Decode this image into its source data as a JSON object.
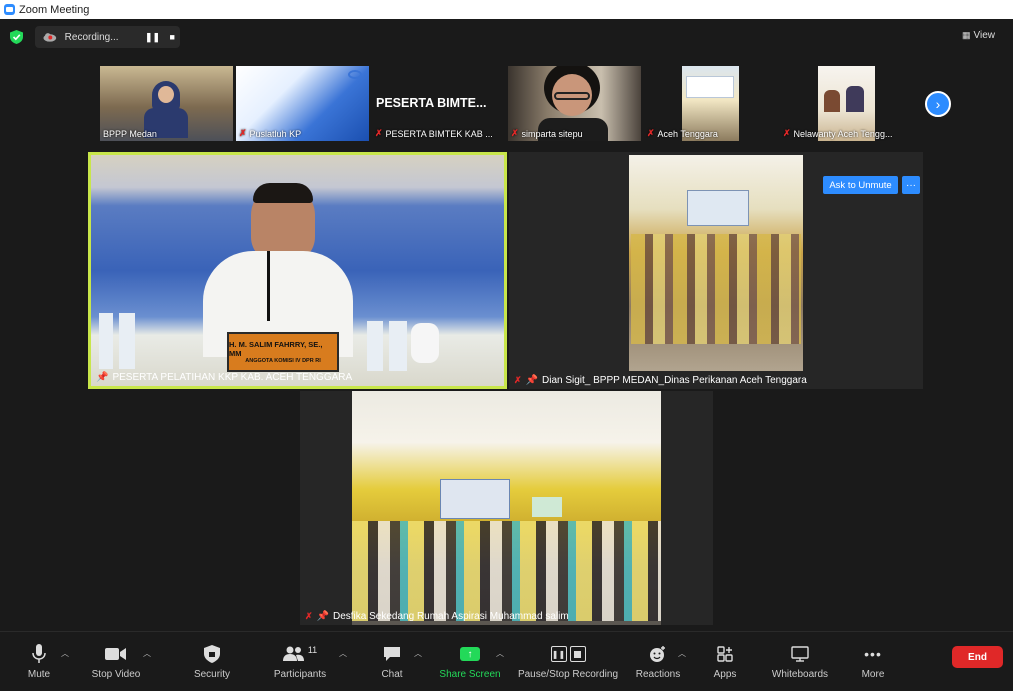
{
  "window": {
    "title": "Zoom Meeting"
  },
  "recording": {
    "label": "Recording..."
  },
  "view": {
    "label": "View"
  },
  "strip": [
    {
      "name": "BPPP Medan",
      "muted": false
    },
    {
      "name": "Puslatluh KP",
      "muted": true
    },
    {
      "name": "PESERTA BIMTEK KAB ...",
      "muted": true,
      "big_text": "PESERTA  BIMTE..."
    },
    {
      "name": "simparta sitepu",
      "muted": true
    },
    {
      "name": "Aceh Tenggara",
      "muted": true
    },
    {
      "name": "Nelawanty Aceh Tengg...",
      "muted": true
    }
  ],
  "speaker": {
    "name": "PESERTA PELATIHAN KKP KAB. ACEH TENGGARA",
    "nameplate": "H. M. SALIM FAHRRY, SE., MM",
    "nameplate_sub": "ANGGOTA KOMISI IV DPR RI"
  },
  "tile2": {
    "name": "Dian Sigit_ BPPP MEDAN_Dinas Perikanan Aceh Tenggara",
    "unmute_label": "Ask to Unmute",
    "more_label": "···"
  },
  "tile3": {
    "name": "Desfika Sekedang Rumah Aspirasi Muhammad salim"
  },
  "toolbar": {
    "mute": "Mute",
    "stop_video": "Stop Video",
    "security": "Security",
    "participants": "Participants",
    "participants_count": "11",
    "chat": "Chat",
    "share": "Share Screen",
    "recording": "Pause/Stop Recording",
    "reactions": "Reactions",
    "apps": "Apps",
    "whiteboards": "Whiteboards",
    "more": "More",
    "end": "End"
  },
  "colors": {
    "accent": "#2d8cff",
    "end": "#e02828",
    "share": "#23d959",
    "active_border": "#c8e64a"
  }
}
